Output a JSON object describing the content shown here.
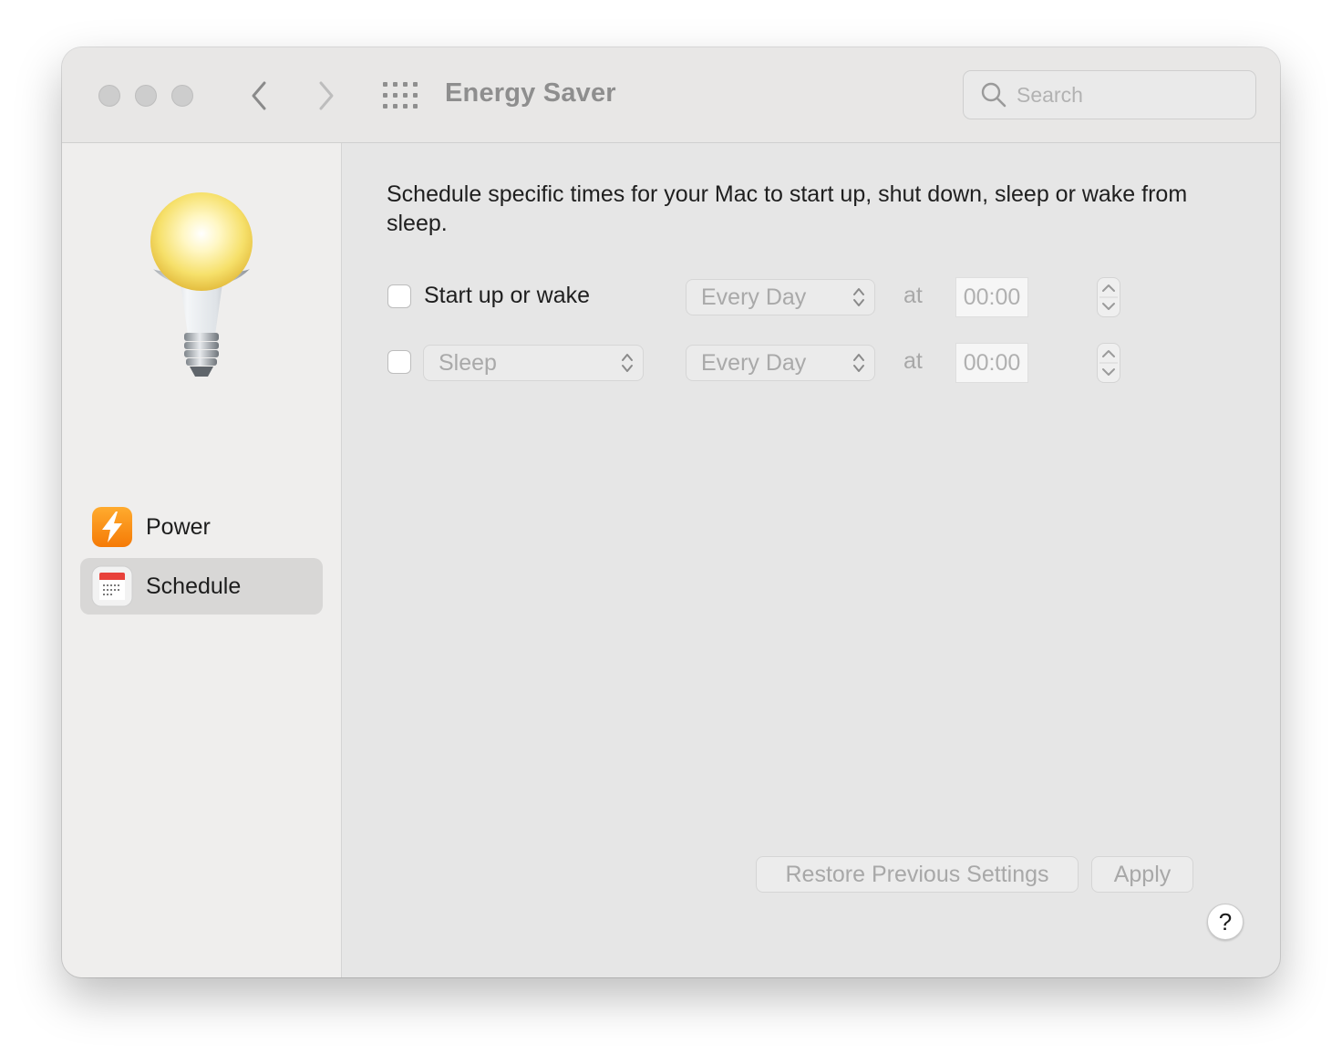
{
  "window": {
    "title": "Energy Saver",
    "search_placeholder": "Search"
  },
  "sidebar": {
    "items": [
      {
        "label": "Power",
        "icon": "lightning-bolt-icon",
        "selected": false
      },
      {
        "label": "Schedule",
        "icon": "calendar-icon",
        "selected": true
      }
    ]
  },
  "schedule": {
    "description": "Schedule specific times for your Mac to start up, shut down, sleep or wake from sleep.",
    "row1": {
      "checked": false,
      "label": "Start up or wake",
      "day_value": "Every Day",
      "at_label": "at",
      "time_value": "00:00"
    },
    "row2": {
      "checked": false,
      "action_value": "Sleep",
      "day_value": "Every Day",
      "at_label": "at",
      "time_value": "00:00"
    }
  },
  "footer": {
    "restore_label": "Restore Previous Settings",
    "apply_label": "Apply",
    "help_label": "?"
  },
  "colors": {
    "window_bg": "#e6e6e6",
    "sidebar_bg": "#efeeed",
    "selected_bg": "#d8d7d6",
    "power_icon": "#f58a0b",
    "calendar_red": "#e8413a"
  }
}
